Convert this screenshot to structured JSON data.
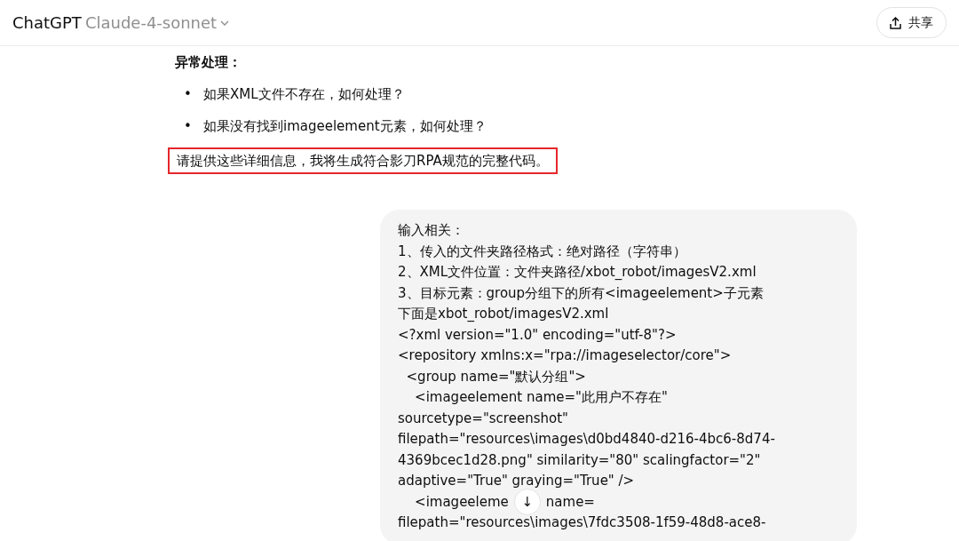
{
  "header": {
    "app_name": "ChatGPT",
    "model": "Claude-4-sonnet",
    "share_button": "共享"
  },
  "assistant": {
    "heading": "异常处理：",
    "bullets": [
      {
        "marker": "•",
        "text": "如果XML文件不存在，如何处理？"
      },
      {
        "marker": "•",
        "text": "如果没有找到imageelement元素，如何处理？"
      }
    ],
    "closing": "请提供这些详细信息，我将生成符合影刀RPA规范的完整代码。",
    "closing_highlighted": true
  },
  "user_message": {
    "lines": [
      {
        "text": "输入相关："
      },
      {
        "text": "1、传入的文件夹路径格式：绝对路径（字符串）"
      },
      {
        "text": "2、XML文件位置：文件夹路径/xbot_robot/imagesV2.xml"
      },
      {
        "text": "3、目标元素：group分组下的所有<imageelement>子元素"
      },
      {
        "text": "下面是xbot_robot/imagesV2.xml"
      },
      {
        "text": "<?xml version=\"1.0\" encoding=\"utf-8\"?>"
      },
      {
        "text": "<repository xmlns:x=\"rpa://imageselector/core\">"
      },
      {
        "text": "  <group name=\"默认分组\">"
      },
      {
        "text": "    <imageelement name=\"此用户不存在\""
      },
      {
        "text": "sourcetype=\"screenshot\""
      },
      {
        "text": "filepath=\"resources\\images\\d0bd4840-d216-4bc6-8d74-"
      },
      {
        "text": "4369bcec1d28.png\" similarity=\"80\" scalingfactor=\"2\""
      },
      {
        "text": "adaptive=\"True\" graying=\"True\" />"
      },
      {
        "text": "    <imageeleme",
        "text_after_button": "name="
      },
      {
        "text": "filepath=\"resources\\images\\7fdc3508-1f59-48d8-ace8-"
      }
    ]
  },
  "scroll_down_button": "↓"
}
